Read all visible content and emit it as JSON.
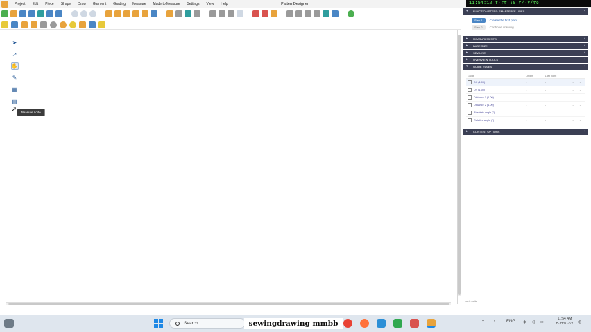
{
  "window": {
    "title": "PatternDesigner",
    "clock_overlay": "11:54:12 ١٤٠٢/٠٧/٢٥ ٢٠٢٣"
  },
  "menu": [
    "Project",
    "Edit",
    "Piece",
    "Shape",
    "Draw",
    "Garment",
    "Grading",
    "Measure",
    "Made to Measure",
    "Settings",
    "View",
    "Help"
  ],
  "left_tools": {
    "items": [
      "select-arrow-icon",
      "curve-tool-icon",
      "hand-tool-icon",
      "pen-tool-icon",
      "measure-node-icon",
      "folder-icon"
    ],
    "tooltip": "Measure node"
  },
  "panel": {
    "title": "Function steps: Smartfree lines",
    "steps": [
      {
        "label": "Step 1",
        "text": "Create the first point",
        "active": true
      },
      {
        "label": "Step 2",
        "text": "Continue drawing",
        "active": false
      }
    ],
    "sections": [
      "Measurements",
      "Base size",
      "Sewline",
      "Overview tools",
      "Guide rules"
    ],
    "table": {
      "headers": [
        "Guide",
        "Origin",
        "Last point",
        "",
        ""
      ],
      "rows": [
        {
          "name": "DX (1.00)",
          "icon": "dx-icon",
          "cells": [
            "-",
            "-",
            "-",
            "-"
          ]
        },
        {
          "name": "DY (1.00)",
          "icon": "dy-icon",
          "cells": [
            "-",
            "-",
            "-",
            "-"
          ]
        },
        {
          "name": "Distance 1 (1.00)",
          "icon": "distance-icon",
          "cells": [
            "-",
            "-",
            "-",
            "-"
          ]
        },
        {
          "name": "Distance 2 (1.00)",
          "icon": "distance-icon",
          "cells": [
            "-",
            "-",
            "-",
            "-"
          ]
        },
        {
          "name": "Absolute angle (°)",
          "icon": "absolute-angle-icon",
          "cells": [
            "-",
            "-",
            "-",
            "-"
          ]
        },
        {
          "name": "Relative angle (°)",
          "icon": "relative-angle-icon",
          "cells": [
            "-",
            "-",
            "-",
            "-"
          ]
        }
      ]
    },
    "footer_section": "Content options",
    "units": "cm/s units"
  },
  "taskbar": {
    "search": "Search",
    "lang": "ENG",
    "time": "11:54 AM",
    "date": "٢٠٢٣/١٠/١٧"
  },
  "watermark": "sewingdrawing mmbb",
  "colors": {
    "panel_header": "#3b3f54",
    "accent": "#4a86c5",
    "clock_text": "#5df05d"
  }
}
